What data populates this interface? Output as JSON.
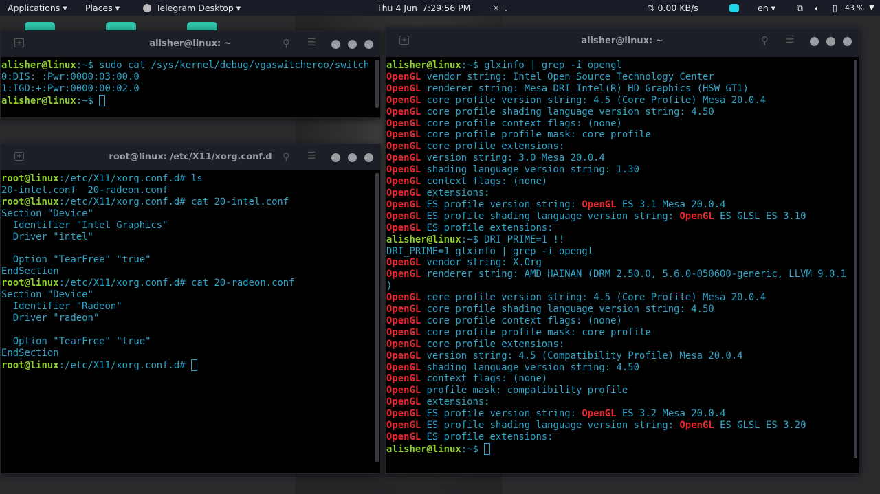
{
  "topbar": {
    "applications": "Applications ▾",
    "places": "Places ▾",
    "app": "Telegram Desktop ▾",
    "date": "Thu 4 Jun",
    "time": "7:29:56 PM",
    "weather": ".",
    "net": "⇅ 0.00 KB/s",
    "lang": "en ▾",
    "battery": "43 %"
  },
  "windows": [
    {
      "title": "alisher@linux: ~",
      "lines": [
        [
          [
            "p",
            "alisher@linux"
          ],
          [
            "c",
            ":~$ sudo cat /sys/kernel/debug/vgaswitcheroo/switch"
          ]
        ],
        [
          [
            "c",
            "0:DIS: :Pwr:0000:03:00.0"
          ]
        ],
        [
          [
            "c",
            "1:IGD:+:Pwr:0000:00:02.0"
          ]
        ],
        [
          [
            "p",
            "alisher@linux"
          ],
          [
            "c",
            ":~$ "
          ],
          [
            "cur",
            ""
          ]
        ]
      ]
    },
    {
      "title": "root@linux: /etc/X11/xorg.conf.d",
      "lines": [
        [
          [
            "p",
            "root@linux"
          ],
          [
            "c",
            ":/etc/X11/xorg.conf.d# ls"
          ]
        ],
        [
          [
            "c",
            "20-intel.conf  20-radeon.conf"
          ]
        ],
        [
          [
            "p",
            "root@linux"
          ],
          [
            "c",
            ":/etc/X11/xorg.conf.d# cat 20-intel.conf"
          ]
        ],
        [
          [
            "c",
            "Section \"Device\""
          ]
        ],
        [
          [
            "c",
            "  Identifier \"Intel Graphics\""
          ]
        ],
        [
          [
            "c",
            "  Driver \"intel\""
          ]
        ],
        [
          [
            "c",
            ""
          ]
        ],
        [
          [
            "c",
            "  Option \"TearFree\" \"true\""
          ]
        ],
        [
          [
            "c",
            "EndSection"
          ]
        ],
        [
          [
            "p",
            "root@linux"
          ],
          [
            "c",
            ":/etc/X11/xorg.conf.d# cat 20-radeon.conf"
          ]
        ],
        [
          [
            "c",
            "Section \"Device\""
          ]
        ],
        [
          [
            "c",
            "  Identifier \"Radeon\""
          ]
        ],
        [
          [
            "c",
            "  Driver \"radeon\""
          ]
        ],
        [
          [
            "c",
            ""
          ]
        ],
        [
          [
            "c",
            "  Option \"TearFree\" \"true\""
          ]
        ],
        [
          [
            "c",
            "EndSection"
          ]
        ],
        [
          [
            "p",
            "root@linux"
          ],
          [
            "c",
            ":/etc/X11/xorg.conf.d# "
          ],
          [
            "cur",
            ""
          ]
        ]
      ]
    },
    {
      "title": "alisher@linux: ~",
      "lines": [
        [
          [
            "p",
            "alisher@linux"
          ],
          [
            "c",
            ":~$ glxinfo | grep -i opengl"
          ]
        ],
        [
          [
            "r",
            "OpenGL"
          ],
          [
            "c",
            " vendor string: Intel Open Source Technology Center"
          ]
        ],
        [
          [
            "r",
            "OpenGL"
          ],
          [
            "c",
            " renderer string: Mesa DRI Intel(R) HD Graphics (HSW GT1)"
          ]
        ],
        [
          [
            "r",
            "OpenGL"
          ],
          [
            "c",
            " core profile version string: 4.5 (Core Profile) Mesa 20.0.4"
          ]
        ],
        [
          [
            "r",
            "OpenGL"
          ],
          [
            "c",
            " core profile shading language version string: 4.50"
          ]
        ],
        [
          [
            "r",
            "OpenGL"
          ],
          [
            "c",
            " core profile context flags: (none)"
          ]
        ],
        [
          [
            "r",
            "OpenGL"
          ],
          [
            "c",
            " core profile profile mask: core profile"
          ]
        ],
        [
          [
            "r",
            "OpenGL"
          ],
          [
            "c",
            " core profile extensions:"
          ]
        ],
        [
          [
            "r",
            "OpenGL"
          ],
          [
            "c",
            " version string: 3.0 Mesa 20.0.4"
          ]
        ],
        [
          [
            "r",
            "OpenGL"
          ],
          [
            "c",
            " shading language version string: 1.30"
          ]
        ],
        [
          [
            "r",
            "OpenGL"
          ],
          [
            "c",
            " context flags: (none)"
          ]
        ],
        [
          [
            "r",
            "OpenGL"
          ],
          [
            "c",
            " extensions:"
          ]
        ],
        [
          [
            "r",
            "OpenGL"
          ],
          [
            "c",
            " ES profile version string: "
          ],
          [
            "r",
            "OpenGL"
          ],
          [
            "c",
            " ES 3.1 Mesa 20.0.4"
          ]
        ],
        [
          [
            "r",
            "OpenGL"
          ],
          [
            "c",
            " ES profile shading language version string: "
          ],
          [
            "r",
            "OpenGL"
          ],
          [
            "c",
            " ES GLSL ES 3.10"
          ]
        ],
        [
          [
            "r",
            "OpenGL"
          ],
          [
            "c",
            " ES profile extensions:"
          ]
        ],
        [
          [
            "p",
            "alisher@linux"
          ],
          [
            "c",
            ":~$ DRI_PRIME=1 !!"
          ]
        ],
        [
          [
            "c",
            "DRI_PRIME=1 glxinfo | grep -i opengl"
          ]
        ],
        [
          [
            "r",
            "OpenGL"
          ],
          [
            "c",
            " vendor string: X.Org"
          ]
        ],
        [
          [
            "r",
            "OpenGL"
          ],
          [
            "c",
            " renderer string: AMD HAINAN (DRM 2.50.0, 5.6.0-050600-generic, LLVM 9.0.1"
          ]
        ],
        [
          [
            "c",
            ")"
          ]
        ],
        [
          [
            "r",
            "OpenGL"
          ],
          [
            "c",
            " core profile version string: 4.5 (Core Profile) Mesa 20.0.4"
          ]
        ],
        [
          [
            "r",
            "OpenGL"
          ],
          [
            "c",
            " core profile shading language version string: 4.50"
          ]
        ],
        [
          [
            "r",
            "OpenGL"
          ],
          [
            "c",
            " core profile context flags: (none)"
          ]
        ],
        [
          [
            "r",
            "OpenGL"
          ],
          [
            "c",
            " core profile profile mask: core profile"
          ]
        ],
        [
          [
            "r",
            "OpenGL"
          ],
          [
            "c",
            " core profile extensions:"
          ]
        ],
        [
          [
            "r",
            "OpenGL"
          ],
          [
            "c",
            " version string: 4.5 (Compatibility Profile) Mesa 20.0.4"
          ]
        ],
        [
          [
            "r",
            "OpenGL"
          ],
          [
            "c",
            " shading language version string: 4.50"
          ]
        ],
        [
          [
            "r",
            "OpenGL"
          ],
          [
            "c",
            " context flags: (none)"
          ]
        ],
        [
          [
            "r",
            "OpenGL"
          ],
          [
            "c",
            " profile mask: compatibility profile"
          ]
        ],
        [
          [
            "r",
            "OpenGL"
          ],
          [
            "c",
            " extensions:"
          ]
        ],
        [
          [
            "r",
            "OpenGL"
          ],
          [
            "c",
            " ES profile version string: "
          ],
          [
            "r",
            "OpenGL"
          ],
          [
            "c",
            " ES 3.2 Mesa 20.0.4"
          ]
        ],
        [
          [
            "r",
            "OpenGL"
          ],
          [
            "c",
            " ES profile shading language version string: "
          ],
          [
            "r",
            "OpenGL"
          ],
          [
            "c",
            " ES GLSL ES 3.20"
          ]
        ],
        [
          [
            "r",
            "OpenGL"
          ],
          [
            "c",
            " ES profile extensions:"
          ]
        ],
        [
          [
            "p",
            "alisher@linux"
          ],
          [
            "c",
            ":~$ "
          ],
          [
            "cur",
            ""
          ]
        ]
      ]
    }
  ]
}
